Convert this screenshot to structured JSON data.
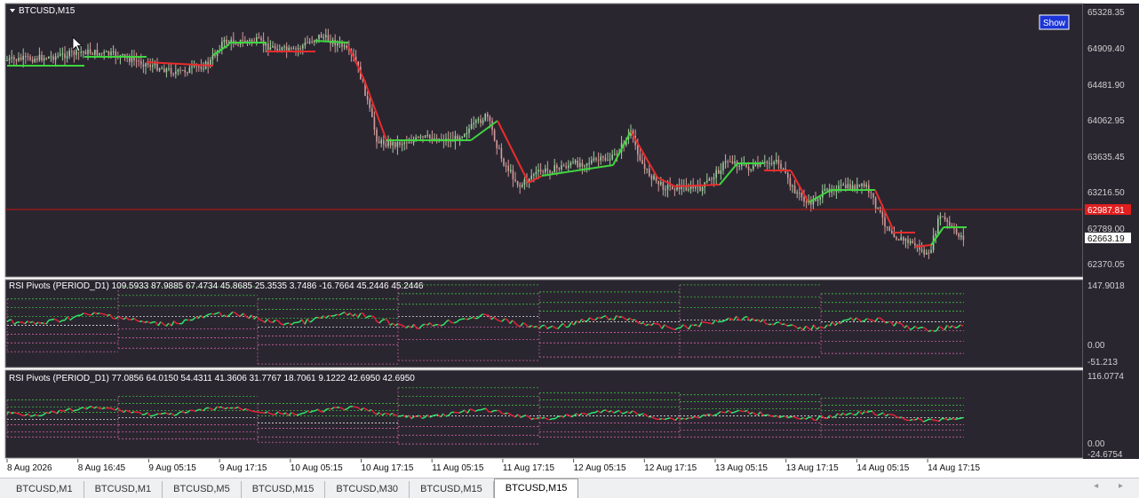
{
  "chart": {
    "symbol_label": "BTCUSD,M15",
    "show_button": "Show",
    "price_ticks": [
      "65328.35",
      "64909.40",
      "64481.90",
      "64062.95",
      "63635.45",
      "63216.50",
      "62789.00",
      "62370.05"
    ],
    "hline_price_label": "62987.81",
    "current_price_label": "62663.19",
    "colors": {
      "background": "#2a2630",
      "up": "#3fd63f",
      "down": "#e82c2c",
      "hline": "#c81414"
    }
  },
  "indicator1": {
    "label": "RSI Pivots (PERIOD_D1) 109.5933 87.9885 67.4734 45.8685 25.3535 3.7486 -16.7664 45.2446 45.2446",
    "ticks": [
      "147.9018",
      "0.00",
      "-51.213"
    ]
  },
  "indicator2": {
    "label": "RSI Pivots (PERIOD_D1) 77.0856 64.0150 54.4311 41.3606 31.7767 18.7061 9.1222 42.6950 42.6950",
    "ticks": [
      "116.0774",
      "0.00",
      "-24.6754"
    ]
  },
  "time_axis": [
    "8 Aug 2026",
    "8 Aug 16:45",
    "9 Aug 05:15",
    "9 Aug 17:15",
    "10 Aug 05:15",
    "10 Aug 17:15",
    "11 Aug 05:15",
    "11 Aug 17:15",
    "12 Aug 05:15",
    "12 Aug 17:15",
    "13 Aug 05:15",
    "13 Aug 17:15",
    "14 Aug 05:15",
    "14 Aug 17:15"
  ],
  "tabs": [
    {
      "label": "BTCUSD,M1",
      "active": false
    },
    {
      "label": "BTCUSD,M1",
      "active": false
    },
    {
      "label": "BTCUSD,M5",
      "active": false
    },
    {
      "label": "BTCUSD,M15",
      "active": false
    },
    {
      "label": "BTCUSD,M30",
      "active": false
    },
    {
      "label": "BTCUSD,M15",
      "active": false
    },
    {
      "label": "BTCUSD,M15",
      "active": true
    }
  ],
  "icons": {
    "collapse": "triangle-down-icon",
    "cursor": "mouse-pointer-icon",
    "scroll": "scroll-arrows-icon"
  }
}
